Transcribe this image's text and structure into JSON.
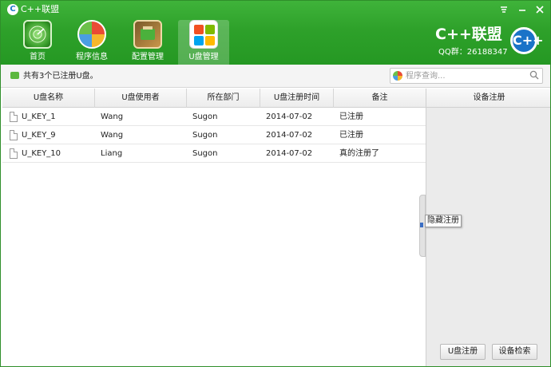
{
  "window": {
    "title": "C++联盟",
    "menu_icon": "menu-icon",
    "minimize_icon": "minimize-icon",
    "close_icon": "close-icon"
  },
  "nav": {
    "items": [
      {
        "label": "首页",
        "icon": "home-radar-icon",
        "active": false
      },
      {
        "label": "程序信息",
        "icon": "program-info-icon",
        "active": false
      },
      {
        "label": "配置管理",
        "icon": "config-manage-icon",
        "active": false
      },
      {
        "label": "U盘管理",
        "icon": "udisk-manage-icon",
        "active": true
      }
    ]
  },
  "brand": {
    "name": "C++联盟",
    "qq": "QQ群：26188347",
    "logo_text": "C++"
  },
  "info": {
    "text": "共有3个已注册U盘。"
  },
  "search": {
    "placeholder": "程序查询..."
  },
  "table": {
    "columns": [
      "U盘名称",
      "U盘使用者",
      "所在部门",
      "U盘注册时间",
      "备注"
    ],
    "rows": [
      {
        "name": "U_KEY_1",
        "user": "Wang",
        "dept": "Sugon",
        "date": "2014-07-02",
        "note": "已注册"
      },
      {
        "name": "U_KEY_9",
        "user": "Wang",
        "dept": "Sugon",
        "date": "2014-07-02",
        "note": "已注册"
      },
      {
        "name": "U_KEY_10",
        "user": "Liang",
        "dept": "Sugon",
        "date": "2014-07-02",
        "note": "真的注册了"
      }
    ]
  },
  "right_panel": {
    "title": "设备注册",
    "register_button": "U盘注册",
    "search_button": "设备检索"
  },
  "tooltip": {
    "text": "隐藏注册"
  },
  "colors": {
    "header_green": "#2ea12a",
    "brand_blue": "#1a73c8"
  }
}
